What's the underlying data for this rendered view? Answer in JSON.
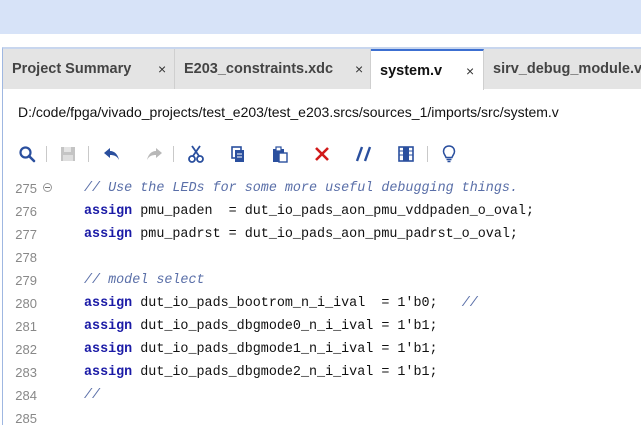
{
  "tabs": [
    {
      "label": "Project Summary",
      "close": "×",
      "active": false
    },
    {
      "label": "E203_constraints.xdc",
      "close": "×",
      "active": false
    },
    {
      "label": "system.v",
      "close": "×",
      "active": true
    },
    {
      "label": "sirv_debug_module.v",
      "close": "",
      "active": false
    }
  ],
  "file_path": "D:/code/fpga/vivado_projects/test_e203/test_e203.srcs/sources_1/imports/src/system.v",
  "toolbar": {
    "icons": [
      "search-icon",
      "save-icon",
      "undo-icon",
      "redo-icon",
      "cut-icon",
      "copy-icon",
      "paste-icon",
      "delete-icon",
      "comment-icon",
      "column-select-icon",
      "lightbulb-icon"
    ],
    "colors": {
      "icon_blue": "#2a4f9e",
      "delete_red": "#d11a1a",
      "disabled_gray": "#b8b8b8"
    }
  },
  "editor": {
    "lines": [
      {
        "no": "275",
        "fold": true,
        "kw": "",
        "code": "",
        "comment": "// Use the LEDs for some more useful debugging things."
      },
      {
        "no": "276",
        "fold": false,
        "kw": "assign",
        "code": " pmu_paden  = dut_io_pads_aon_pmu_vddpaden_o_oval;",
        "comment": ""
      },
      {
        "no": "277",
        "fold": false,
        "kw": "assign",
        "code": " pmu_padrst = dut_io_pads_aon_pmu_padrst_o_oval;",
        "comment": ""
      },
      {
        "no": "278",
        "fold": false,
        "kw": "",
        "code": "",
        "comment": ""
      },
      {
        "no": "279",
        "fold": false,
        "kw": "",
        "code": "",
        "comment": "// model select"
      },
      {
        "no": "280",
        "fold": false,
        "kw": "assign",
        "code": " dut_io_pads_bootrom_n_i_ival  = 1'b0;   ",
        "comment": "//"
      },
      {
        "no": "281",
        "fold": false,
        "kw": "assign",
        "code": " dut_io_pads_dbgmode0_n_i_ival = 1'b1;",
        "comment": ""
      },
      {
        "no": "282",
        "fold": false,
        "kw": "assign",
        "code": " dut_io_pads_dbgmode1_n_i_ival = 1'b1;",
        "comment": ""
      },
      {
        "no": "283",
        "fold": false,
        "kw": "assign",
        "code": " dut_io_pads_dbgmode2_n_i_ival = 1'b1;",
        "comment": ""
      },
      {
        "no": "284",
        "fold": false,
        "kw": "",
        "code": "",
        "comment": "//"
      },
      {
        "no": "285",
        "fold": false,
        "kw": "",
        "code": "",
        "comment": ""
      }
    ]
  }
}
